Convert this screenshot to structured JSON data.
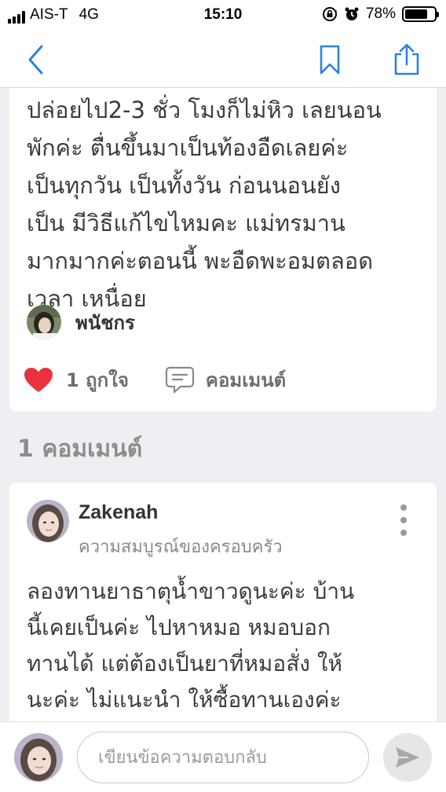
{
  "status_bar": {
    "carrier": "AIS-T",
    "network": "4G",
    "time": "15:10",
    "battery_percent": "78%",
    "battery_level": 0.78
  },
  "nav": {
    "back_icon": "chevron-left-icon",
    "bookmark_icon": "bookmark-icon",
    "share_icon": "share-icon",
    "accent_color": "#2a82e4"
  },
  "post": {
    "body": "ปล่อยไป2-3 ชั่ว โมงก็ไม่หิว เลยนอน\nพักค่ะ ตื่นขึ้นมาเป็นท้องอืดเลยค่ะ\nเป็นทุกวัน เป็นทั้งวัน ก่อนนอนยัง\nเป็น มีวิธีแก้ไขไหมคะ แม่ทรมาน\nมากมากค่ะตอนนี้ พะอืดพะอมตลอด\nเวลา เหนื่อย",
    "author": "พนัชกร",
    "like_label": "1 ถูกใจ",
    "comment_label": "คอมเมนต์",
    "like_color": "#e8323f"
  },
  "comments": {
    "header": "1 คอมเมนต์",
    "items": [
      {
        "name": "Zakenah",
        "subtitle": "ความสมบูรณ์ของครอบครัว",
        "body": "ลองทานยาธาตุน้ำขาวดูนะค่ะ บ้าน\nนี้เคยเป็นค่ะ ไปหาหมอ หมอบอก\nทานได้ แต่ต้องเป็นยาที่หมอสั่ง ให้\nนะค่ะ ไม่แนะนำ ให้ซื้อทานเองค่ะ"
      }
    ]
  },
  "reply": {
    "placeholder": "เขียนข้อความตอบกลับ",
    "send_icon": "send-icon"
  }
}
